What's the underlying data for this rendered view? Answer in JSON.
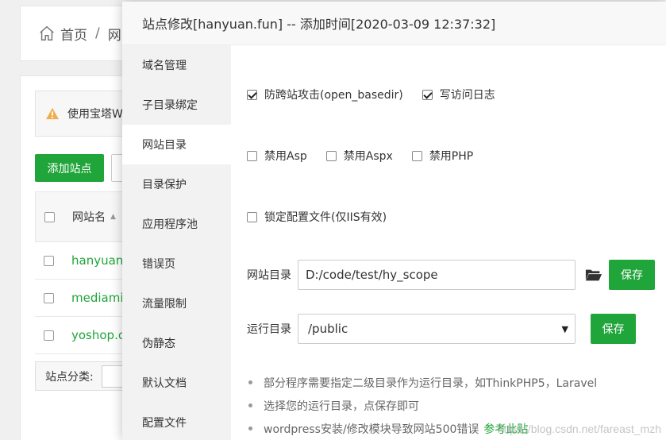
{
  "background": {
    "breadcrumb": {
      "home": "首页",
      "separator": "/",
      "next": "网"
    },
    "warning_text": "使用宝塔W",
    "add_site_button": "添加站点",
    "table": {
      "header": "网站名",
      "rows": [
        "hanyuan.",
        "mediami",
        "yoshop.c"
      ]
    },
    "category_label": "站点分类:"
  },
  "modal": {
    "title": "站点修改[hanyuan.fun] -- 添加时间[2020-03-09 12:37:32]",
    "sidebar": {
      "items": [
        {
          "label": "域名管理"
        },
        {
          "label": "子目录绑定"
        },
        {
          "label": "网站目录",
          "active": true
        },
        {
          "label": "目录保护"
        },
        {
          "label": "应用程序池"
        },
        {
          "label": "错误页"
        },
        {
          "label": "流量限制"
        },
        {
          "label": "伪静态"
        },
        {
          "label": "默认文档"
        },
        {
          "label": "配置文件"
        }
      ]
    },
    "options": {
      "anti_cross": {
        "label": "防跨站攻击(open_basedir)",
        "checked": true
      },
      "access_log": {
        "label": "写访问日志",
        "checked": true
      },
      "disable_asp": {
        "label": "禁用Asp",
        "checked": false
      },
      "disable_aspx": {
        "label": "禁用Aspx",
        "checked": false
      },
      "disable_php": {
        "label": "禁用PHP",
        "checked": false
      },
      "lock_config": {
        "label": "锁定配置文件(仅IIS有效)",
        "checked": false
      }
    },
    "site_dir": {
      "label": "网站目录",
      "value": "D:/code/test/hy_scope",
      "save_label": "保存"
    },
    "run_dir": {
      "label": "运行目录",
      "value": "/public",
      "save_label": "保存"
    },
    "tips": [
      "部分程序需要指定二级目录作为运行目录，如ThinkPHP5，Laravel",
      "选择您的运行目录，点保存即可",
      "wordpress安装/修改模块导致网站500错误"
    ],
    "tips_link": "参考此贴",
    "watermark": "https://blog.csdn.net/fareast_mzh"
  },
  "colors": {
    "accent": "#20a53a",
    "warning": "#f0ad4e"
  }
}
